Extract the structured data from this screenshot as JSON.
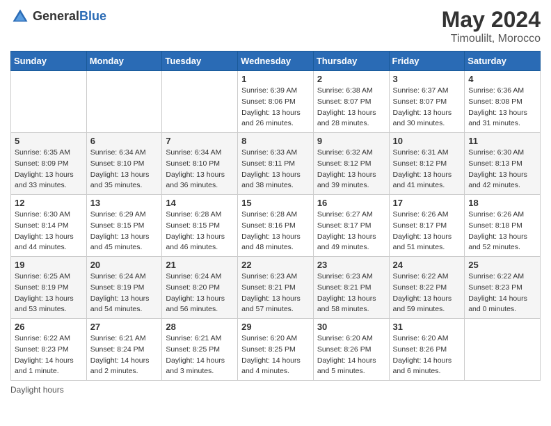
{
  "logo": {
    "text_general": "General",
    "text_blue": "Blue",
    "tagline": "Timoulilt, Morocco"
  },
  "title": "May 2024",
  "subtitle": "Timoulilt, Morocco",
  "days_of_week": [
    "Sunday",
    "Monday",
    "Tuesday",
    "Wednesday",
    "Thursday",
    "Friday",
    "Saturday"
  ],
  "footer": "Daylight hours",
  "weeks": [
    [
      {
        "day": "",
        "sunrise": "",
        "sunset": "",
        "daylight": ""
      },
      {
        "day": "",
        "sunrise": "",
        "sunset": "",
        "daylight": ""
      },
      {
        "day": "",
        "sunrise": "",
        "sunset": "",
        "daylight": ""
      },
      {
        "day": "1",
        "sunrise": "Sunrise: 6:39 AM",
        "sunset": "Sunset: 8:06 PM",
        "daylight": "Daylight: 13 hours and 26 minutes."
      },
      {
        "day": "2",
        "sunrise": "Sunrise: 6:38 AM",
        "sunset": "Sunset: 8:07 PM",
        "daylight": "Daylight: 13 hours and 28 minutes."
      },
      {
        "day": "3",
        "sunrise": "Sunrise: 6:37 AM",
        "sunset": "Sunset: 8:07 PM",
        "daylight": "Daylight: 13 hours and 30 minutes."
      },
      {
        "day": "4",
        "sunrise": "Sunrise: 6:36 AM",
        "sunset": "Sunset: 8:08 PM",
        "daylight": "Daylight: 13 hours and 31 minutes."
      }
    ],
    [
      {
        "day": "5",
        "sunrise": "Sunrise: 6:35 AM",
        "sunset": "Sunset: 8:09 PM",
        "daylight": "Daylight: 13 hours and 33 minutes."
      },
      {
        "day": "6",
        "sunrise": "Sunrise: 6:34 AM",
        "sunset": "Sunset: 8:10 PM",
        "daylight": "Daylight: 13 hours and 35 minutes."
      },
      {
        "day": "7",
        "sunrise": "Sunrise: 6:34 AM",
        "sunset": "Sunset: 8:10 PM",
        "daylight": "Daylight: 13 hours and 36 minutes."
      },
      {
        "day": "8",
        "sunrise": "Sunrise: 6:33 AM",
        "sunset": "Sunset: 8:11 PM",
        "daylight": "Daylight: 13 hours and 38 minutes."
      },
      {
        "day": "9",
        "sunrise": "Sunrise: 6:32 AM",
        "sunset": "Sunset: 8:12 PM",
        "daylight": "Daylight: 13 hours and 39 minutes."
      },
      {
        "day": "10",
        "sunrise": "Sunrise: 6:31 AM",
        "sunset": "Sunset: 8:12 PM",
        "daylight": "Daylight: 13 hours and 41 minutes."
      },
      {
        "day": "11",
        "sunrise": "Sunrise: 6:30 AM",
        "sunset": "Sunset: 8:13 PM",
        "daylight": "Daylight: 13 hours and 42 minutes."
      }
    ],
    [
      {
        "day": "12",
        "sunrise": "Sunrise: 6:30 AM",
        "sunset": "Sunset: 8:14 PM",
        "daylight": "Daylight: 13 hours and 44 minutes."
      },
      {
        "day": "13",
        "sunrise": "Sunrise: 6:29 AM",
        "sunset": "Sunset: 8:15 PM",
        "daylight": "Daylight: 13 hours and 45 minutes."
      },
      {
        "day": "14",
        "sunrise": "Sunrise: 6:28 AM",
        "sunset": "Sunset: 8:15 PM",
        "daylight": "Daylight: 13 hours and 46 minutes."
      },
      {
        "day": "15",
        "sunrise": "Sunrise: 6:28 AM",
        "sunset": "Sunset: 8:16 PM",
        "daylight": "Daylight: 13 hours and 48 minutes."
      },
      {
        "day": "16",
        "sunrise": "Sunrise: 6:27 AM",
        "sunset": "Sunset: 8:17 PM",
        "daylight": "Daylight: 13 hours and 49 minutes."
      },
      {
        "day": "17",
        "sunrise": "Sunrise: 6:26 AM",
        "sunset": "Sunset: 8:17 PM",
        "daylight": "Daylight: 13 hours and 51 minutes."
      },
      {
        "day": "18",
        "sunrise": "Sunrise: 6:26 AM",
        "sunset": "Sunset: 8:18 PM",
        "daylight": "Daylight: 13 hours and 52 minutes."
      }
    ],
    [
      {
        "day": "19",
        "sunrise": "Sunrise: 6:25 AM",
        "sunset": "Sunset: 8:19 PM",
        "daylight": "Daylight: 13 hours and 53 minutes."
      },
      {
        "day": "20",
        "sunrise": "Sunrise: 6:24 AM",
        "sunset": "Sunset: 8:19 PM",
        "daylight": "Daylight: 13 hours and 54 minutes."
      },
      {
        "day": "21",
        "sunrise": "Sunrise: 6:24 AM",
        "sunset": "Sunset: 8:20 PM",
        "daylight": "Daylight: 13 hours and 56 minutes."
      },
      {
        "day": "22",
        "sunrise": "Sunrise: 6:23 AM",
        "sunset": "Sunset: 8:21 PM",
        "daylight": "Daylight: 13 hours and 57 minutes."
      },
      {
        "day": "23",
        "sunrise": "Sunrise: 6:23 AM",
        "sunset": "Sunset: 8:21 PM",
        "daylight": "Daylight: 13 hours and 58 minutes."
      },
      {
        "day": "24",
        "sunrise": "Sunrise: 6:22 AM",
        "sunset": "Sunset: 8:22 PM",
        "daylight": "Daylight: 13 hours and 59 minutes."
      },
      {
        "day": "25",
        "sunrise": "Sunrise: 6:22 AM",
        "sunset": "Sunset: 8:23 PM",
        "daylight": "Daylight: 14 hours and 0 minutes."
      }
    ],
    [
      {
        "day": "26",
        "sunrise": "Sunrise: 6:22 AM",
        "sunset": "Sunset: 8:23 PM",
        "daylight": "Daylight: 14 hours and 1 minute."
      },
      {
        "day": "27",
        "sunrise": "Sunrise: 6:21 AM",
        "sunset": "Sunset: 8:24 PM",
        "daylight": "Daylight: 14 hours and 2 minutes."
      },
      {
        "day": "28",
        "sunrise": "Sunrise: 6:21 AM",
        "sunset": "Sunset: 8:25 PM",
        "daylight": "Daylight: 14 hours and 3 minutes."
      },
      {
        "day": "29",
        "sunrise": "Sunrise: 6:20 AM",
        "sunset": "Sunset: 8:25 PM",
        "daylight": "Daylight: 14 hours and 4 minutes."
      },
      {
        "day": "30",
        "sunrise": "Sunrise: 6:20 AM",
        "sunset": "Sunset: 8:26 PM",
        "daylight": "Daylight: 14 hours and 5 minutes."
      },
      {
        "day": "31",
        "sunrise": "Sunrise: 6:20 AM",
        "sunset": "Sunset: 8:26 PM",
        "daylight": "Daylight: 14 hours and 6 minutes."
      },
      {
        "day": "",
        "sunrise": "",
        "sunset": "",
        "daylight": ""
      }
    ]
  ]
}
